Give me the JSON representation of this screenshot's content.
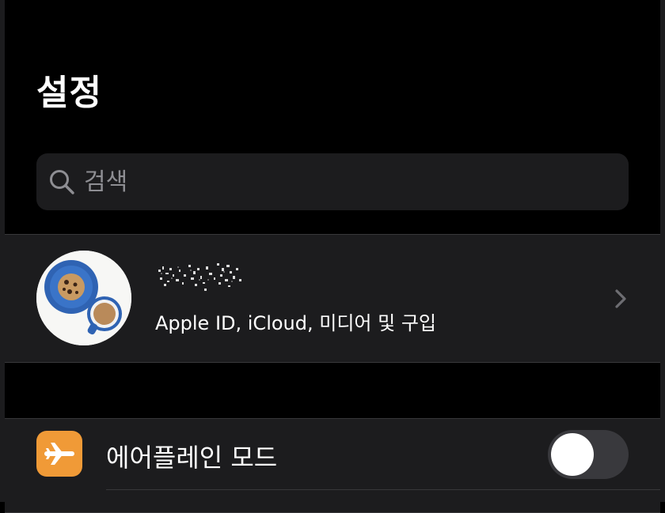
{
  "header": {
    "title": "설정"
  },
  "search": {
    "placeholder": "검색",
    "icon": "search-icon"
  },
  "account": {
    "name_redacted": true,
    "subtitle": "Apple ID, iCloud, 미디어 및 구입",
    "avatar_description_icon": "cookie-and-coffee-photo",
    "chevron_icon": "chevron-right-icon"
  },
  "settings": {
    "items": [
      {
        "label": "에어플레인 모드",
        "icon": "airplane-icon",
        "icon_color": "#f09a37",
        "toggle_on": false
      }
    ]
  },
  "colors": {
    "background": "#000000",
    "group_background": "#1c1c1e",
    "secondary_text": "#8e8e93",
    "toggle_off": "#39393d",
    "separator": "#38383a"
  }
}
